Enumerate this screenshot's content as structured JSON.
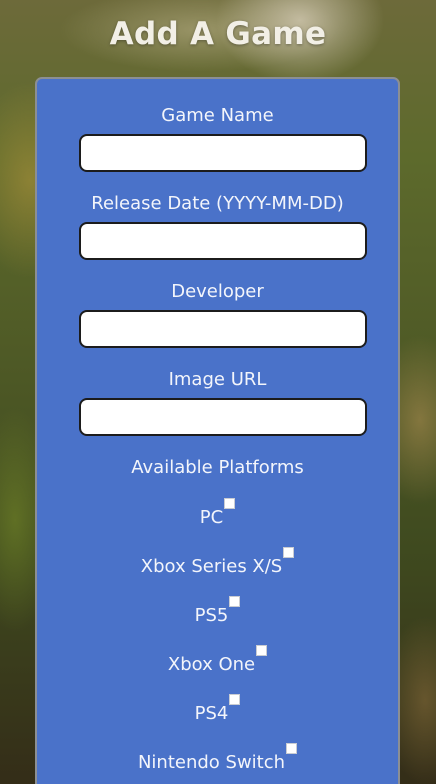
{
  "page": {
    "title": "Add A Game"
  },
  "form": {
    "fields": [
      {
        "label": "Game Name",
        "value": "",
        "placeholder": ""
      },
      {
        "label": "Release Date (YYYY-MM-DD)",
        "value": "",
        "placeholder": ""
      },
      {
        "label": "Developer",
        "value": "",
        "placeholder": ""
      },
      {
        "label": "Image URL",
        "value": "",
        "placeholder": ""
      }
    ],
    "platforms_heading": "Available Platforms",
    "platforms": [
      {
        "label": "PC",
        "checked": false
      },
      {
        "label": "Xbox Series X/S",
        "checked": false
      },
      {
        "label": "PS5",
        "checked": false
      },
      {
        "label": "Xbox One",
        "checked": false
      },
      {
        "label": "PS4",
        "checked": false
      },
      {
        "label": "Nintendo Switch",
        "checked": false
      }
    ]
  },
  "colors": {
    "card_background": "#4a72c9",
    "card_border": "#8c8f93",
    "text": "#f3f5fb",
    "input_border": "#1c1c1c"
  }
}
